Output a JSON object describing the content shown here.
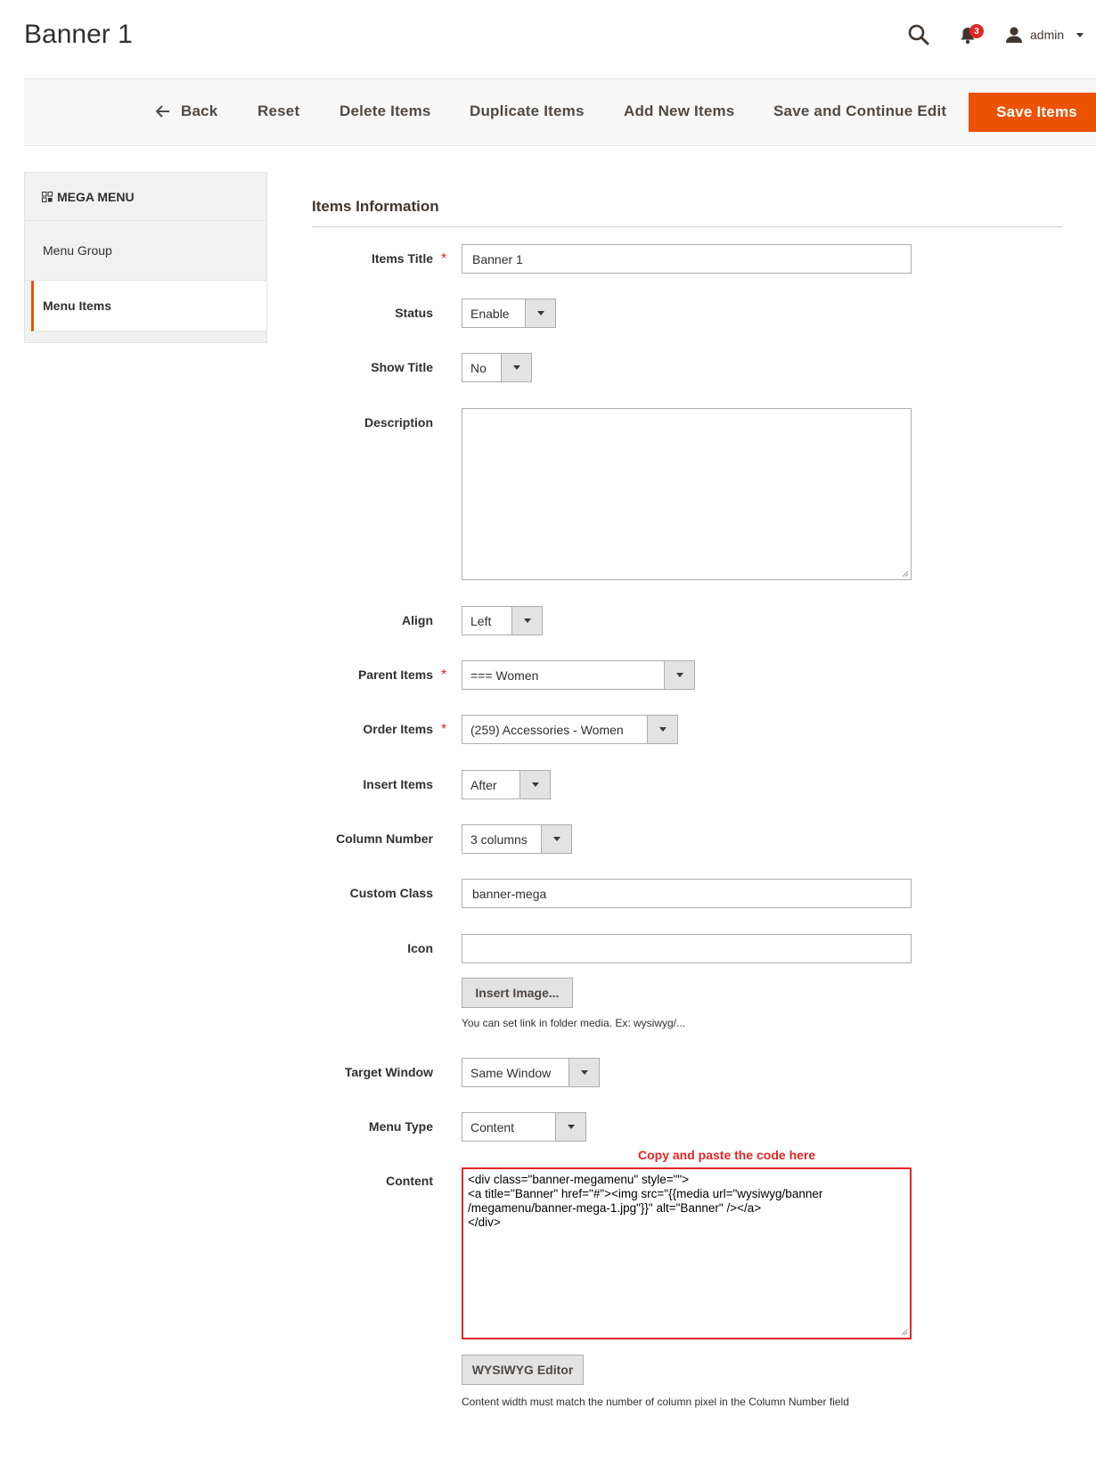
{
  "page": {
    "title": "Banner 1"
  },
  "header": {
    "user_name": "admin",
    "notification_count": "3"
  },
  "toolbar": {
    "back": "Back",
    "reset": "Reset",
    "delete": "Delete Items",
    "duplicate": "Duplicate Items",
    "add_new": "Add New Items",
    "save_continue": "Save and Continue Edit",
    "save": "Save Items"
  },
  "sidebar": {
    "title": "MEGA MENU",
    "items": [
      {
        "label": "Menu Group"
      },
      {
        "label": "Menu Items"
      }
    ]
  },
  "form": {
    "section_title": "Items Information",
    "items_title": {
      "label": "Items Title",
      "value": "Banner 1"
    },
    "status": {
      "label": "Status",
      "value": "Enable"
    },
    "show_title": {
      "label": "Show Title",
      "value": "No"
    },
    "description": {
      "label": "Description",
      "value": ""
    },
    "align": {
      "label": "Align",
      "value": "Left"
    },
    "parent_items": {
      "label": "Parent Items",
      "value": "=== Women"
    },
    "order_items": {
      "label": "Order Items",
      "value": "(259) Accessories - Women"
    },
    "insert_items": {
      "label": "Insert Items",
      "value": "After"
    },
    "column_number": {
      "label": "Column Number",
      "value": "3 columns"
    },
    "custom_class": {
      "label": "Custom Class",
      "value": "banner-mega"
    },
    "icon": {
      "label": "Icon",
      "value": "",
      "button": "Insert Image...",
      "note": "You can set link in folder media. Ex: wysiwyg/..."
    },
    "target_window": {
      "label": "Target Window",
      "value": "Same Window"
    },
    "menu_type": {
      "label": "Menu Type",
      "value": "Content"
    },
    "content": {
      "label": "Content",
      "annotation": "Copy and paste the code here",
      "value": "<div class=\"banner-megamenu\" style=\"\">\n<a title=\"Banner\" href=\"#\"><img src=\"{{media url=\"wysiwyg/banner\n/megamenu/banner-mega-1.jpg\"}}\" alt=\"Banner\" /></a>\n</div>",
      "button": "WYSIWYG Editor",
      "note": "Content width must match the number of column pixel in the Column Number field"
    }
  },
  "colors": {
    "accent": "#eb5202",
    "required": "#e22626",
    "highlight_border": "#e22626"
  }
}
